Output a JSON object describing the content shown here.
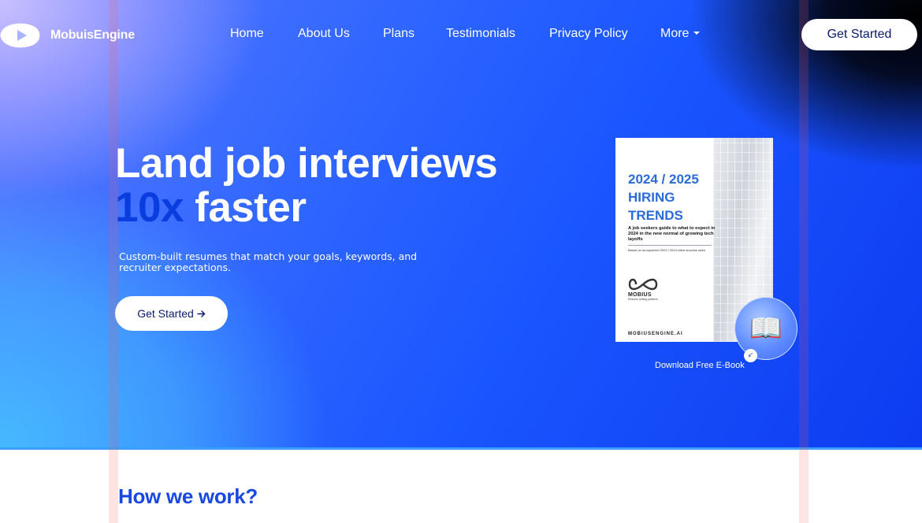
{
  "brand": {
    "name": "MobuisEngine",
    "logo_icon": "logo-icon"
  },
  "nav": {
    "items": [
      {
        "label": "Home"
      },
      {
        "label": "About Us"
      },
      {
        "label": "Plans"
      },
      {
        "label": "Testimonials"
      },
      {
        "label": "Privacy Policy"
      },
      {
        "label": "More",
        "icon": "caret-down-icon"
      }
    ],
    "cta_label": "Get Started"
  },
  "hero": {
    "headline_line1": "Land job interviews",
    "headline_accent": "10x",
    "headline_rest": "faster",
    "subtext": "Custom-built resumes that match your goals, keywords, and recruiter expectations.",
    "cta_label": "Get Started",
    "cta_icon": "arrow-right-icon"
  },
  "ebook": {
    "title": "2024 / 2025 HIRING TRENDS",
    "description": "A job seekers guide to what to expect in 2024 in the new normal of growing tech layoffs",
    "note": "Based on anonymized 2023 / 2024 client success rates",
    "brand_name": "MOBIUS",
    "brand_tagline": "Resume writing platform",
    "site": "MOBIUSENGINE.AI",
    "badge_icon": "open-book-icon",
    "badge_arrow_icon": "arrow-down-left-icon",
    "caption": "Download Free E-Book"
  },
  "section": {
    "title": "How we work?"
  },
  "colors": {
    "hero_blue": "#1a55ff",
    "accent_blue": "#0a3de0",
    "ebook_title": "#2a6bd8",
    "section_title": "#1848e0",
    "cta_text": "#0a1a6e"
  }
}
